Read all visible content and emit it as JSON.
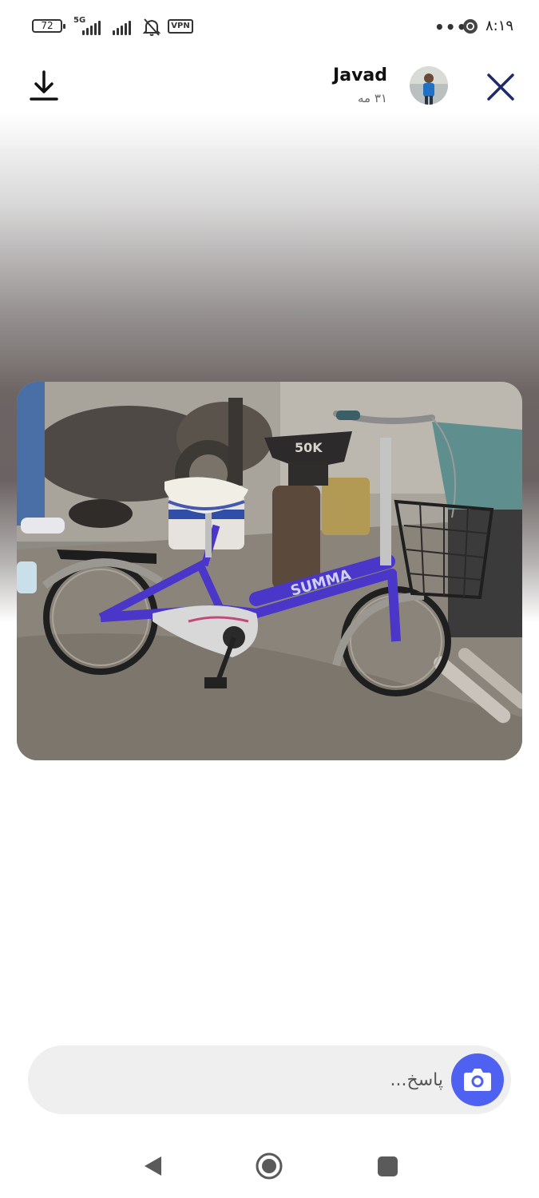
{
  "status_bar": {
    "battery_level": "72",
    "network_type": "5G",
    "vpn_label": "VPN",
    "overflow": "•••",
    "time": "۸:۱۹"
  },
  "header": {
    "user_name": "Javad",
    "post_date": "۳۱ مه"
  },
  "photo": {
    "brand_text": "SUMMA",
    "anvil_text": "50K"
  },
  "reply": {
    "placeholder": "پاسخ..."
  },
  "colors": {
    "accent": "#4f61f0",
    "close_icon": "#1f2a6b",
    "reply_bg": "#efefef"
  },
  "icons": {
    "download": "download-icon",
    "close": "close-icon",
    "camera": "camera-icon",
    "nav_back": "triangle-back-icon",
    "nav_home": "circle-home-icon",
    "nav_recent": "square-recents-icon"
  }
}
